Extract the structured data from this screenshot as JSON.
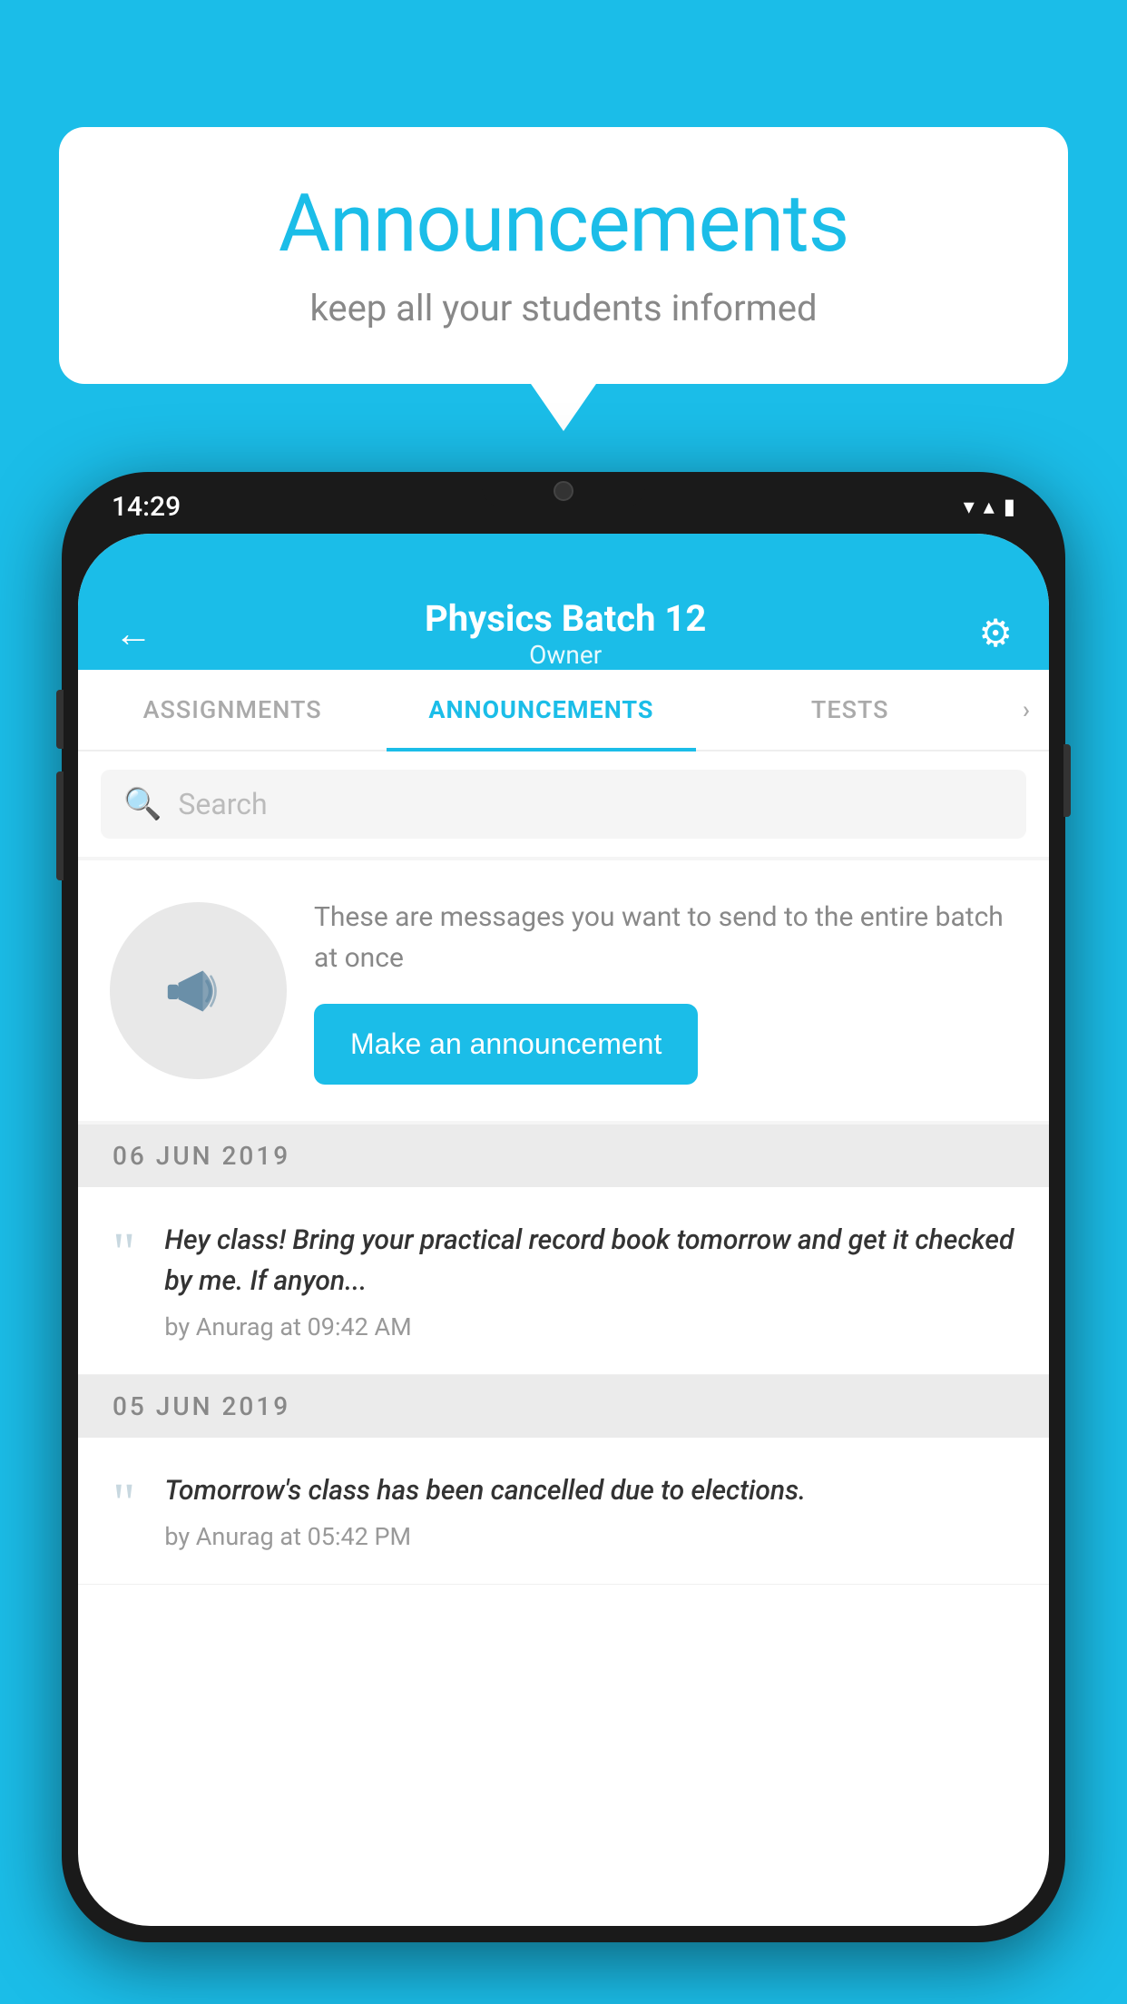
{
  "background_color": "#1bbde8",
  "speech_bubble": {
    "title": "Announcements",
    "subtitle": "keep all your students informed"
  },
  "phone": {
    "status_bar": {
      "time": "14:29",
      "icons": [
        "wifi",
        "signal",
        "battery"
      ]
    },
    "header": {
      "title": "Physics Batch 12",
      "subtitle": "Owner",
      "back_label": "←",
      "gear_label": "⚙"
    },
    "tabs": [
      {
        "label": "ASSIGNMENTS",
        "active": false
      },
      {
        "label": "ANNOUNCEMENTS",
        "active": true
      },
      {
        "label": "TESTS",
        "active": false
      },
      {
        "label": "›",
        "active": false
      }
    ],
    "search": {
      "placeholder": "Search"
    },
    "promo": {
      "description": "These are messages you want to send to the entire batch at once",
      "button_label": "Make an announcement"
    },
    "announcements": [
      {
        "date": "06  JUN  2019",
        "text": "Hey class! Bring your practical record book tomorrow and get it checked by me. If anyon...",
        "meta": "by Anurag at 09:42 AM"
      },
      {
        "date": "05  JUN  2019",
        "text": "Tomorrow's class has been cancelled due to elections.",
        "meta": "by Anurag at 05:42 PM"
      }
    ]
  }
}
